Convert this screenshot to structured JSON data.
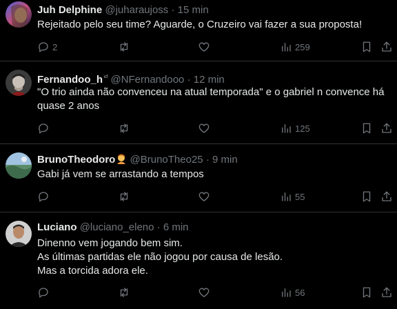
{
  "icons": {
    "reply": "reply-icon",
    "retweet": "retweet-icon",
    "like": "heart-icon",
    "views": "views-icon",
    "bookmark": "bookmark-icon",
    "share": "share-icon"
  },
  "colors": {
    "background": "#000000",
    "text": "#e7e9ea",
    "muted": "#71767b",
    "divider": "#2f3336"
  },
  "tweets": [
    {
      "name": "Juh Delphine",
      "handle": "@juharaujoss",
      "separator": "·",
      "time": "15 min",
      "lines": [
        "Rejeitado pelo seu time? Aguarde, o Cruzeiro vai fazer a sua proposta!"
      ],
      "replies": "2",
      "retweets": "",
      "likes": "",
      "views": "259"
    },
    {
      "name": "Fernandoo_h",
      "name_suffix": "ᶜᶠ",
      "handle": "@NFernandooo",
      "separator": "·",
      "time": "12 min",
      "lines": [
        "\"O trio ainda não convenceu na atual temporada\" e o gabriel n convence há",
        "quase 2 anos"
      ],
      "replies": "",
      "retweets": "",
      "likes": "",
      "views": "125"
    },
    {
      "name": "BrunoTheodoro",
      "handle": "@BrunoTheo25",
      "separator": "·",
      "time": "9 min",
      "lines": [
        "Gabi já vem se arrastando a tempos"
      ],
      "replies": "",
      "retweets": "",
      "likes": "",
      "views": "55"
    },
    {
      "name": "Luciano",
      "handle": "@luciano_eleno",
      "separator": "·",
      "time": "6 min",
      "lines": [
        "Dinenno vem jogando bem sim.",
        "As últimas partidas ele não jogou por causa de lesão.",
        "Mas a torcida adora ele."
      ],
      "replies": "",
      "retweets": "",
      "likes": "",
      "views": "56"
    }
  ]
}
